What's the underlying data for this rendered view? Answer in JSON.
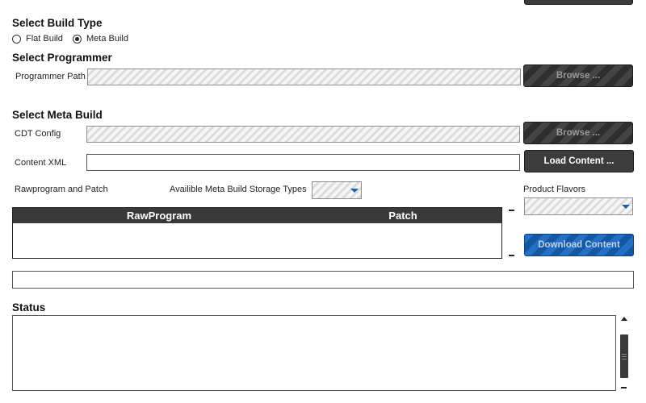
{
  "build_type": {
    "title": "Select Build Type",
    "options": [
      {
        "label": "Flat Build",
        "checked": false
      },
      {
        "label": "Meta Build",
        "checked": true
      }
    ]
  },
  "programmer": {
    "title": "Select Programmer",
    "path_label": "Programmer Path",
    "path_value": "",
    "browse_label": "Browse ..."
  },
  "meta_build": {
    "title": "Select Meta Build",
    "cdt_label": "CDT Config",
    "cdt_value": "",
    "cdt_browse_label": "Browse ...",
    "content_xml_label": "Content XML",
    "content_xml_value": "",
    "load_content_label": "Load Content ...",
    "rawprogram_patch_label": "Rawprogram and Patch",
    "storage_types_label": "Availible Meta Build Storage Types",
    "storage_types_selected": "",
    "product_flavors_label": "Product Flavors",
    "product_flavors_selected": "",
    "table": {
      "columns": [
        "RawProgram",
        "Patch"
      ],
      "rows": []
    },
    "download_label": "Download Content",
    "progress_value": ""
  },
  "status": {
    "title": "Status",
    "text": ""
  },
  "colors": {
    "dark_button": "#3c3c3c",
    "blue_button": "#1a64b8",
    "table_header": "#3a3a3a"
  }
}
